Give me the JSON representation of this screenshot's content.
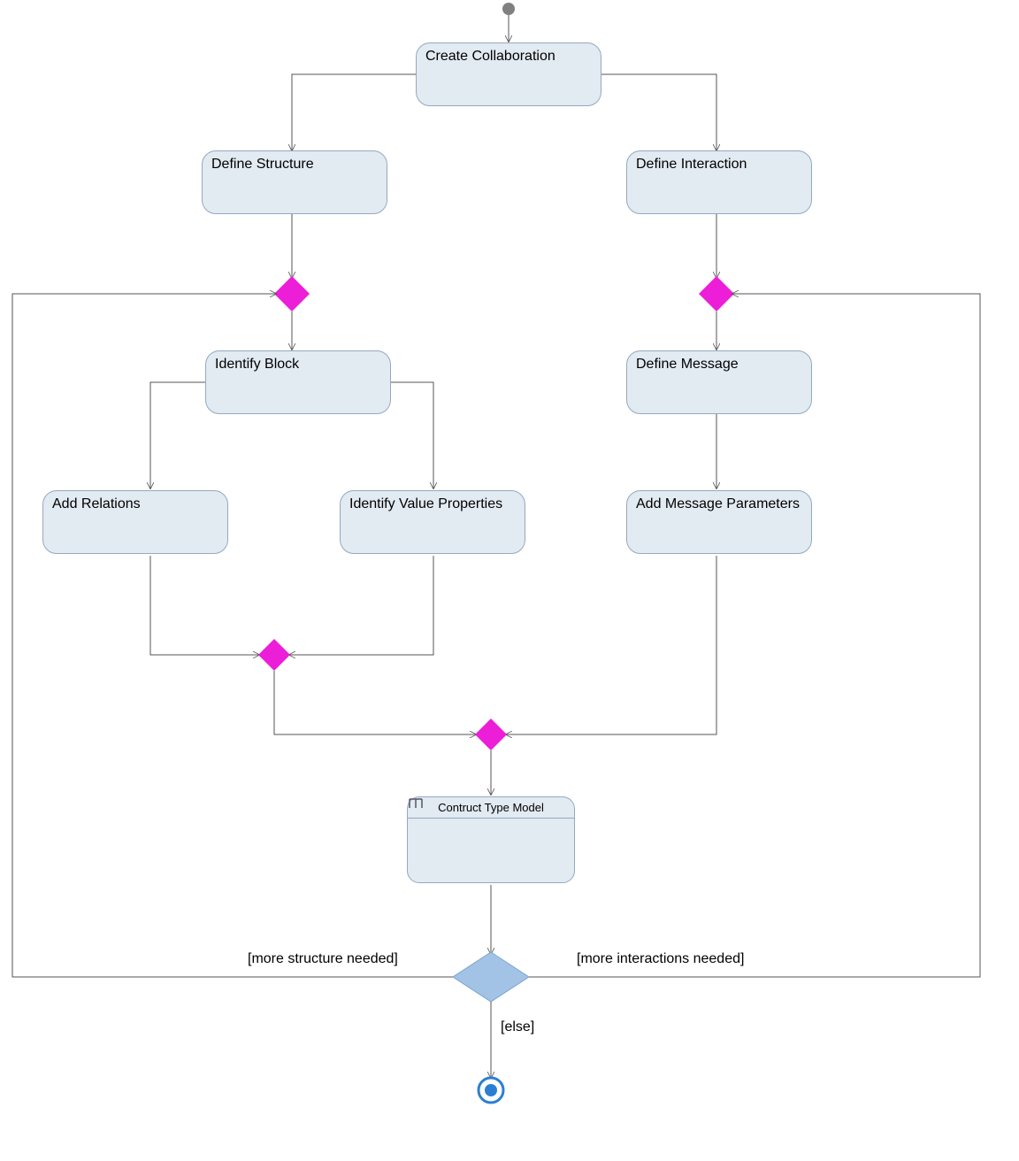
{
  "nodes": {
    "create_collaboration": "Create Collaboration",
    "define_structure": "Define Structure",
    "define_interaction": "Define Interaction",
    "identify_block": "Identify Block",
    "add_relations": "Add Relations",
    "identify_value_properties": "Identify Value Properties",
    "define_message": "Define Message",
    "add_message_parameters": "Add Message Parameters",
    "construct_type_model": "Contruct Type Model"
  },
  "guards": {
    "more_structure": "[more structure needed]",
    "more_interactions": "[more interactions needed]",
    "else": "[else]"
  },
  "colors": {
    "activity_fill": "#e2eaf2",
    "activity_border": "#95a9bf",
    "merge_fill": "#ec1ed8",
    "decision_fill": "#a3c3e6",
    "initial_fill": "#808080",
    "final_ring": "#2b7fd3",
    "final_fill": "#2b7fd3",
    "edge": "#555555"
  }
}
